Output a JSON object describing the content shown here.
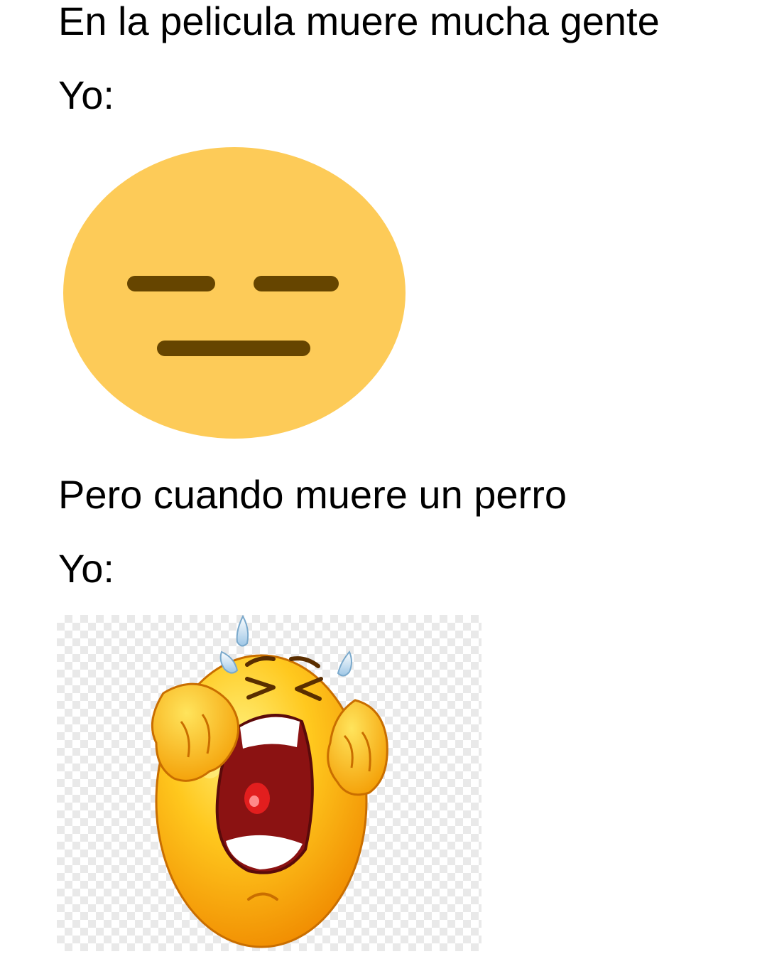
{
  "meme": {
    "setup_1": "En la pelicula muere mucha gente",
    "reaction_label_1": "Yo:",
    "setup_2": "Pero cuando muere un perro",
    "reaction_label_2": "Yo:"
  },
  "images": {
    "first_reaction": "expressionless-face-emoji",
    "second_reaction": "crying-face-emoji"
  },
  "colors": {
    "text": "#000000",
    "background": "#ffffff",
    "neutral_face": "#FDCB58",
    "neutral_features": "#664500",
    "crying_face": "#FFC21A",
    "mouth": "#8B1212"
  }
}
